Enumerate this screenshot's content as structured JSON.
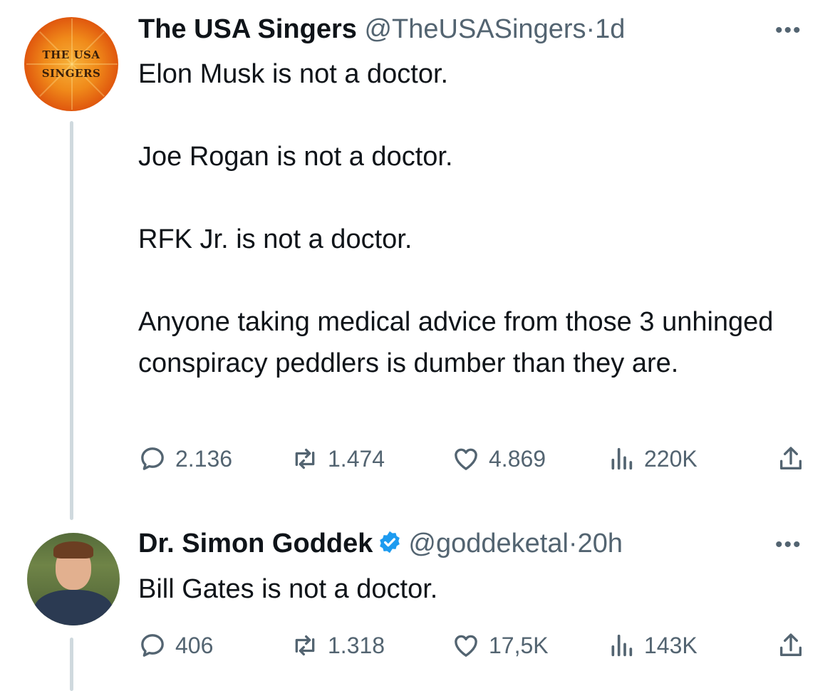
{
  "tweets": [
    {
      "author_name": "The USA Singers",
      "handle": "@TheUSASingers",
      "separator": "·",
      "time": "1d",
      "avatar_text": [
        "THE USA",
        "SINGERS"
      ],
      "verified": false,
      "paragraphs": [
        "Elon Musk is not a doctor.",
        "Joe Rogan is not a doctor.",
        "RFK Jr. is not a doctor.",
        "Anyone taking medical advice from those 3 unhinged conspiracy peddlers is dumber than they are."
      ],
      "stats": {
        "replies": "2.136",
        "reposts": "1.474",
        "likes": "4.869",
        "views": "220K"
      }
    },
    {
      "author_name": "Dr. Simon Goddek",
      "handle": "@goddeketal",
      "separator": "·",
      "time": "20h",
      "verified": true,
      "paragraphs": [
        "Bill Gates is not a doctor."
      ],
      "stats": {
        "replies": "406",
        "reposts": "1.318",
        "likes": "17,5K",
        "views": "143K"
      }
    }
  ],
  "icons": [
    "reply-icon",
    "repost-icon",
    "like-icon",
    "views-icon",
    "share-icon",
    "more-icon",
    "verified-badge-icon"
  ],
  "colors": {
    "text": "#0f1419",
    "secondary": "#536471",
    "thread_line": "#cfd9de",
    "verified": "#1d9bf0"
  }
}
